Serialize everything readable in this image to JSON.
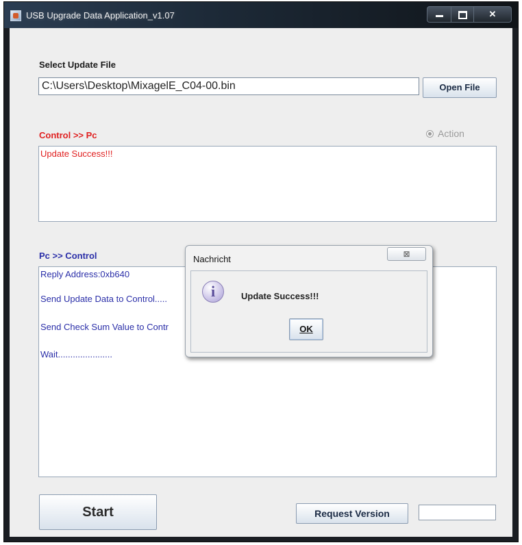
{
  "window": {
    "title": "USB Upgrade Data Application_v1.07"
  },
  "file_section": {
    "label": "Select Update File",
    "path_value": "C:\\Users\\Desktop\\MixagelE_C04-00.bin",
    "open_button": "Open File"
  },
  "control_to_pc": {
    "label": "Control >> Pc",
    "radio_label": "Action",
    "radio_selected": true,
    "lines": [
      "Update Success!!!"
    ]
  },
  "pc_to_control": {
    "label": "Pc >> Control",
    "lines": [
      "Reply Address:0xb640",
      "Send Update Data to Control.....",
      "Send Check Sum Value to Contr",
      "Wait......................"
    ]
  },
  "bottom": {
    "start_button": "Start",
    "request_button": "Request Version",
    "version_value": ""
  },
  "dialog": {
    "title": "Nachricht",
    "close_glyph": "⊠",
    "icon": "info-icon",
    "message": "Update Success!!!",
    "ok_button": "OK"
  },
  "colors": {
    "title_bar": "#1d2a38",
    "red_label": "#e02020",
    "blue_label": "#2a2ea8"
  }
}
